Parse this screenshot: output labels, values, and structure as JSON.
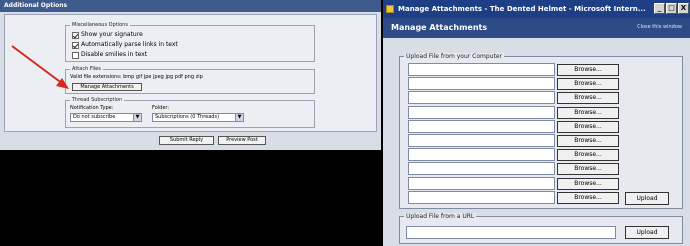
{
  "left": {
    "header_title": "Additional Options",
    "misc": {
      "legend": "Miscellaneous Options",
      "options": [
        {
          "label": "Show your signature",
          "checked": true
        },
        {
          "label": "Automatically parse links in text",
          "checked": true
        },
        {
          "label": "Disable smilies in text",
          "checked": false
        }
      ]
    },
    "attach": {
      "legend": "Attach Files",
      "valid_ext": "Valid file extensions: bmp gif jpe jpeg jpg pdf png zip",
      "manage_label": "Manage Attachments"
    },
    "thread": {
      "legend": "Thread Subscription",
      "notification_label": "Notification Type:",
      "notification_value": "Do not subscribe",
      "folder_label": "Folder:",
      "folder_value": "Subscriptions (0 Threads)"
    },
    "submit_label": "Submit Reply",
    "preview_label": "Preview Post",
    "arrow_color": "#d42a1c"
  },
  "right": {
    "window_title": "Manage Attachments - The Dented Helmet - Microsoft Intern...",
    "window_buttons": [
      "_",
      "□",
      "X"
    ],
    "panel_title": "Manage Attachments",
    "close_link": "Close this window",
    "upload_computer_legend": "Upload File from your Computer",
    "browse_label": "Browse...",
    "browse_count": 10,
    "upload_label": "Upload",
    "upload_url_legend": "Upload File from a URL",
    "url_upload_label": "Upload"
  }
}
